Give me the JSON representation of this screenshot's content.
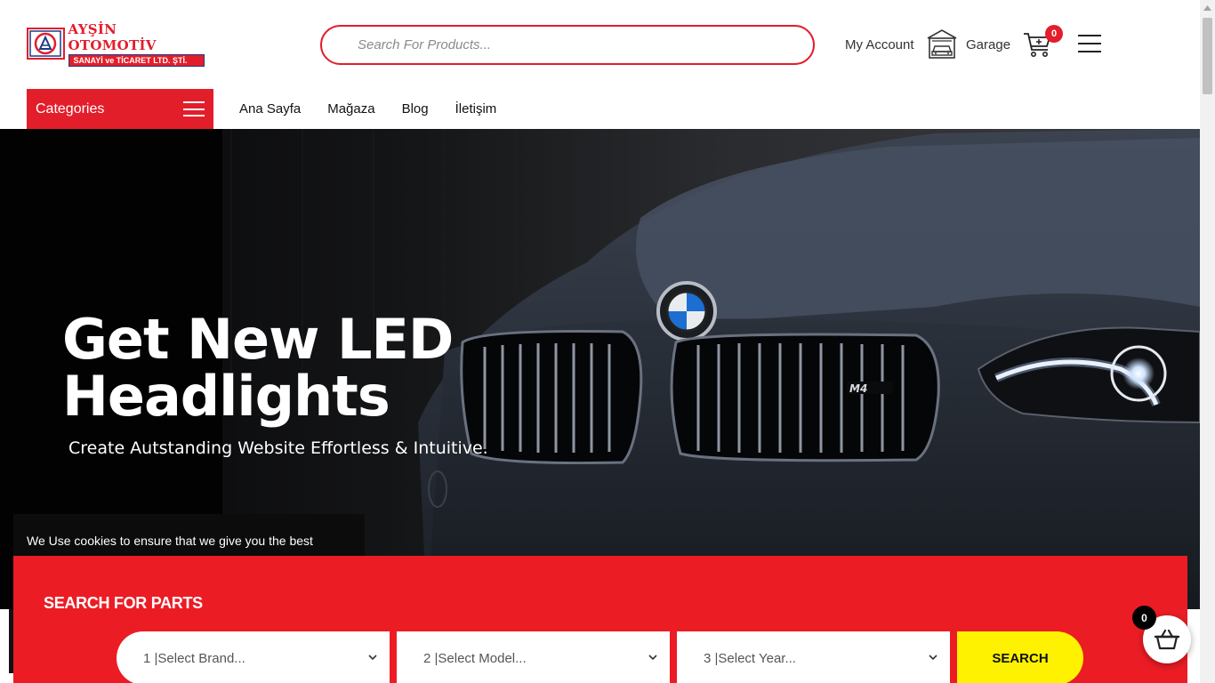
{
  "header": {
    "logo_line1": "AYŞİN OTOMOTİV",
    "logo_line2": "SANAYİ ve TİCARET LTD. ŞTİ.",
    "search_placeholder": "Search For Products...",
    "my_account": "My Account",
    "garage": "Garage",
    "cart_count": "0",
    "icons": [
      "garage-icon",
      "cart-icon",
      "menu-icon"
    ]
  },
  "nav": {
    "categories_label": "Categories",
    "links": [
      "Ana Sayfa",
      "Mağaza",
      "Blog",
      "İletişim"
    ]
  },
  "hero": {
    "title_line1": "Get New LED",
    "title_line2": "Headlights",
    "subtitle": "Create Autstanding Website Effortless & Intuitive.",
    "badge": "M4"
  },
  "cookie": {
    "text": "We Use cookies to ensure that we give you the best"
  },
  "parts_finder": {
    "title": "SEARCH FOR PARTS",
    "brand": "1 |Select Brand...",
    "model": "2 |Select Model...",
    "year": "3 |Select Year...",
    "search_button": "SEARCH"
  },
  "mini_cart": {
    "count": "0"
  },
  "colors": {
    "accent": "#ec1c24",
    "button": "#fff200",
    "hero_bg": "#0a0a0c"
  }
}
